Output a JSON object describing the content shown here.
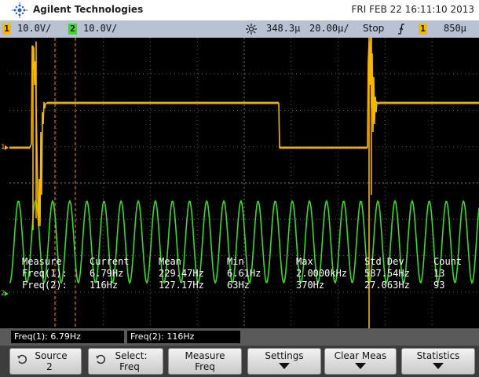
{
  "header": {
    "brand": "Agilent Technologies",
    "datetime": "FRI FEB 22 16:11:10 2013"
  },
  "status": {
    "ch1_badge": "1",
    "ch1_scale": "10.0V/",
    "ch2_badge": "2",
    "ch2_scale": "10.0V/",
    "time_delay": "348.3µ",
    "time_scale": "20.00µ/",
    "run_state": "Stop",
    "trig_badge": "1",
    "trig_level": "850µ"
  },
  "measurements": {
    "headers": [
      "Measure",
      "Current",
      "Mean",
      "Min",
      "Max",
      "Std Dev",
      "Count"
    ],
    "rows": [
      [
        "Freq(1):",
        "6.79Hz",
        "229.47Hz",
        "6.61Hz",
        "2.0000kHz",
        "587.54Hz",
        "13"
      ],
      [
        "Freq(2):",
        "116Hz",
        "127.17Hz",
        "63Hz",
        "370Hz",
        "27.063Hz",
        "93"
      ]
    ]
  },
  "infobar": {
    "freq1": "Freq(1): 6.79Hz",
    "freq2": "Freq(2): 116Hz"
  },
  "softkeys": {
    "source_l1": "Source",
    "source_l2": "2",
    "select_l1": "Select:",
    "select_l2": "Freq",
    "measure_l1": "Measure",
    "measure_l2": "Freq",
    "settings": "Settings",
    "clear": "Clear Meas",
    "statistics": "Statistics"
  },
  "colors": {
    "ch1": "#f5b800",
    "ch2": "#3fd62e",
    "cursor": "#ff8a1a",
    "grid": "#5a5a5a"
  }
}
